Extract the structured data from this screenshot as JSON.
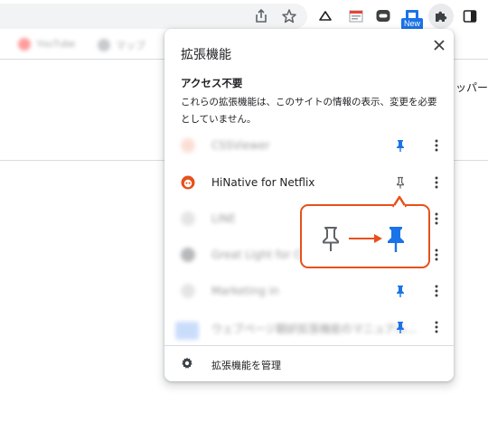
{
  "toolbar": {
    "icons": [
      "share-icon",
      "bookmark-star-icon",
      "cloud-icon",
      "calendar-extension-icon",
      "line-extension-icon",
      "new-extension-icon",
      "puzzle-icon",
      "sidebar-icon"
    ],
    "new_badge": "New"
  },
  "bookmarks": {
    "items": [
      {
        "label": "YouTube",
        "color": "#ff0000"
      },
      {
        "label": "マップ",
        "color": "#9aa0a6"
      }
    ]
  },
  "page": {
    "side_text": "ッパー"
  },
  "popup": {
    "title": "拡張機能",
    "close_icon": "close-icon",
    "section_title": "アクセス不要",
    "section_desc": "これらの拡張機能は、このサイトの情報の表示、変更を必要としていません。",
    "extensions": [
      {
        "name": "CSSViewer",
        "blurred": true,
        "pinned": true,
        "icon_color": "#f5b7a3"
      },
      {
        "name": "HiNative for Netflix",
        "blurred": false,
        "pinned": false,
        "icon_color": "#e8501a"
      },
      {
        "name": "LINE",
        "blurred": true,
        "pinned": false,
        "icon_color": "#c4c7c5"
      },
      {
        "name": "Great Light for Chrome",
        "blurred": true,
        "pinned": false,
        "icon_color": "#5f6368"
      },
      {
        "name": "Marketing in",
        "blurred": true,
        "pinned": true,
        "icon_color": "#c4c7c5"
      },
      {
        "name": "ウェブページ翻訳拡張機能のマニュアル...",
        "blurred": true,
        "pinned": true,
        "icon_color": "#8ab4f8"
      }
    ],
    "manage_label": "拡張機能を管理"
  },
  "colors": {
    "accent_blue": "#1a73e8",
    "annotation_orange": "#e8501a",
    "icon_gray": "#5f6368"
  }
}
